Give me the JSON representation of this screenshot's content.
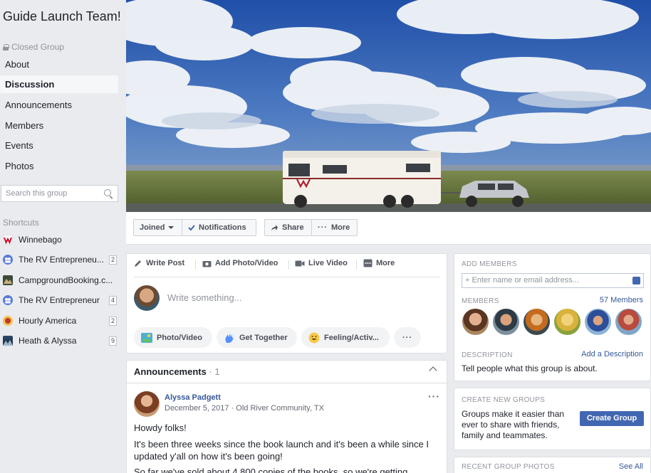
{
  "group": {
    "title": "Guide Launch Team!",
    "privacy": "Closed Group"
  },
  "nav": [
    "About",
    "Discussion",
    "Announcements",
    "Members",
    "Events",
    "Photos"
  ],
  "search": {
    "placeholder": "Search this group"
  },
  "shortcuts": {
    "title": "Shortcuts",
    "items": [
      {
        "label": "Winnebago",
        "count": "",
        "icon": "winnebago-logo-icon"
      },
      {
        "label": "The RV Entrepreneu...",
        "count": "2",
        "icon": "group-icon"
      },
      {
        "label": "CampgroundBooking.c...",
        "count": "",
        "icon": "mountain-logo-icon"
      },
      {
        "label": "The RV Entrepreneur",
        "count": "4",
        "icon": "group-icon"
      },
      {
        "label": "Hourly America",
        "count": "2",
        "icon": "badge-logo-icon"
      },
      {
        "label": "Heath & Alyssa",
        "count": "9",
        "icon": "photo-thumb-icon"
      }
    ]
  },
  "actions": {
    "joined": "Joined",
    "notifications": "Notifications",
    "share": "Share",
    "more": "More"
  },
  "composer": {
    "tabs": [
      "Write Post",
      "Add Photo/Video",
      "Live Video",
      "More"
    ],
    "placeholder": "Write something...",
    "pills": [
      "Photo/Video",
      "Get Together",
      "Feeling/Activ..."
    ]
  },
  "announcements": {
    "title": "Announcements",
    "count": "· 1",
    "post": {
      "author": "Alyssa Padgett",
      "meta": "December 5, 2017 · Old River Community, TX",
      "paragraphs": [
        "Howdy folks!",
        "It's been three weeks since the book launch and it's been a while since I updated y'all on how it's been going!",
        "So far we've sold about 4,800 copies of the books, so we're getting"
      ]
    }
  },
  "add_members": {
    "title": "ADD MEMBERS",
    "input_placeholder": "Enter name or email address...",
    "members_label": "MEMBERS",
    "members_link": "57 Members",
    "description_label": "DESCRIPTION",
    "description_link": "Add a Description",
    "description_text": "Tell people what this group is about."
  },
  "create_groups": {
    "title": "CREATE NEW GROUPS",
    "text": "Groups make it easier than ever to share with friends, family and teammates.",
    "button": "Create Group"
  },
  "recent_photos": {
    "title": "RECENT GROUP PHOTOS",
    "link": "See All"
  },
  "colors": {
    "link": "#365899",
    "primary": "#4267b2",
    "bg": "#e9ebee"
  }
}
